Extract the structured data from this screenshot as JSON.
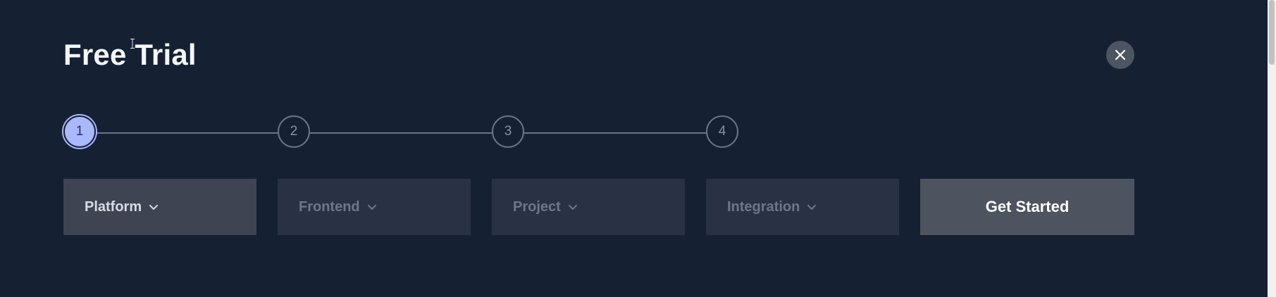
{
  "modal": {
    "title": "Free Trial",
    "close_icon": "close-icon"
  },
  "stepper": {
    "current_step": 1,
    "steps": [
      {
        "label": "1"
      },
      {
        "label": "2"
      },
      {
        "label": "3"
      },
      {
        "label": "4"
      }
    ]
  },
  "selects": [
    {
      "label": "Platform"
    },
    {
      "label": "Frontend"
    },
    {
      "label": "Project"
    },
    {
      "label": "Integration"
    }
  ],
  "cta": {
    "label": "Get Started"
  },
  "colors": {
    "background": "#152033",
    "active_step": "#aab8ff",
    "cta_background": "#4e5360"
  }
}
